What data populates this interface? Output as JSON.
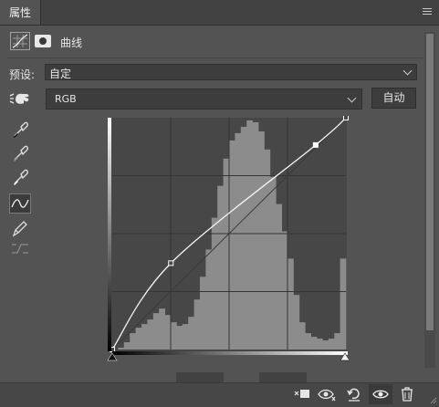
{
  "panel": {
    "tab_label": "属性",
    "title": "曲线",
    "preset_label": "预设:",
    "preset_value": "自定",
    "channel_value": "RGB",
    "auto_label": "自动"
  },
  "icons": {
    "panel_menu": "panel-menu-icon",
    "adjustment_layer": "curves-adjustment-icon",
    "mask": "layer-mask-icon",
    "hand": "targeted-adjustment-hand-icon",
    "eyedroppers": [
      "black-point-eyedropper-icon",
      "gray-point-eyedropper-icon",
      "white-point-eyedropper-icon"
    ],
    "curve_tool": "edit-points-curve-icon",
    "pencil_tool": "draw-pencil-icon",
    "smooth_tool": "smooth-curve-icon",
    "footer": [
      "clip-to-layer-icon",
      "view-previous-state-icon",
      "reset-icon",
      "visibility-eye-icon",
      "delete-trash-icon"
    ]
  },
  "curve": {
    "points": [
      [
        0,
        0
      ],
      [
        64,
        95
      ],
      [
        222,
        225
      ],
      [
        255,
        255
      ]
    ],
    "selected_point": [
      222,
      225
    ]
  },
  "histogram": {
    "bins": [
      0,
      2,
      8,
      18,
      24,
      28,
      33,
      40,
      45,
      38,
      30,
      26,
      28,
      36,
      55,
      80,
      110,
      145,
      180,
      210,
      230,
      238,
      245,
      252,
      250,
      240,
      220,
      190,
      160,
      130,
      100,
      60,
      30,
      18,
      14,
      12,
      10,
      12,
      18,
      100
    ]
  }
}
